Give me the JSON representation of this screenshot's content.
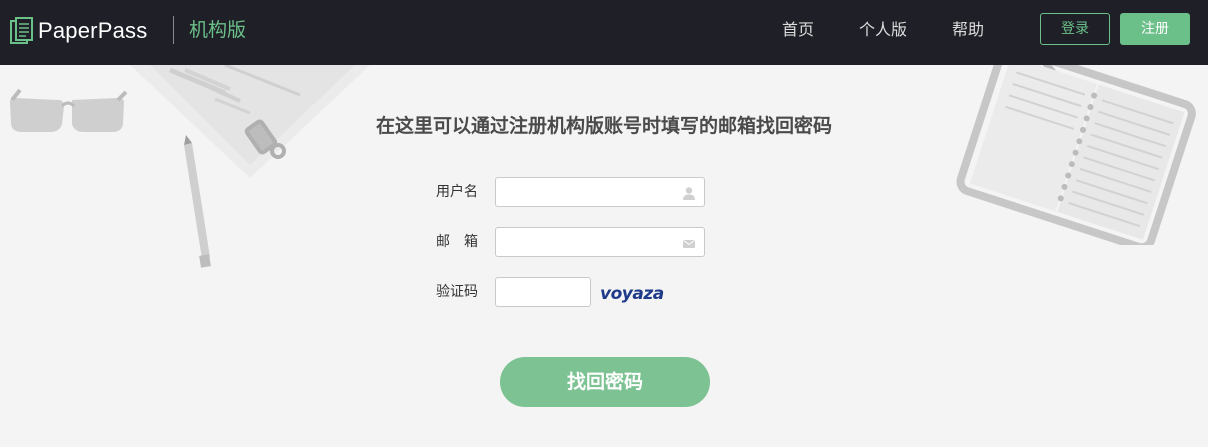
{
  "header": {
    "brand": "PaperPass",
    "edition": "机构版",
    "nav": [
      {
        "label": "首页"
      },
      {
        "label": "个人版"
      },
      {
        "label": "帮助"
      }
    ],
    "login_label": "登录",
    "register_label": "注册"
  },
  "main": {
    "title": "在这里可以通过注册机构版账号时填写的邮箱找回密码",
    "fields": {
      "username": {
        "label": "用户名",
        "value": "",
        "icon": "user-icon"
      },
      "email": {
        "label": "邮　箱",
        "value": "",
        "icon": "envelope-icon"
      },
      "captcha": {
        "label": "验证码",
        "value": "",
        "image_text": "voyaza"
      }
    },
    "submit_label": "找回密码"
  },
  "colors": {
    "header_bg": "#1f2027",
    "accent": "#6bbf88",
    "button_bg": "#7cc293",
    "page_bg": "#f4f4f4",
    "captcha_text": "#1e3a8a"
  }
}
